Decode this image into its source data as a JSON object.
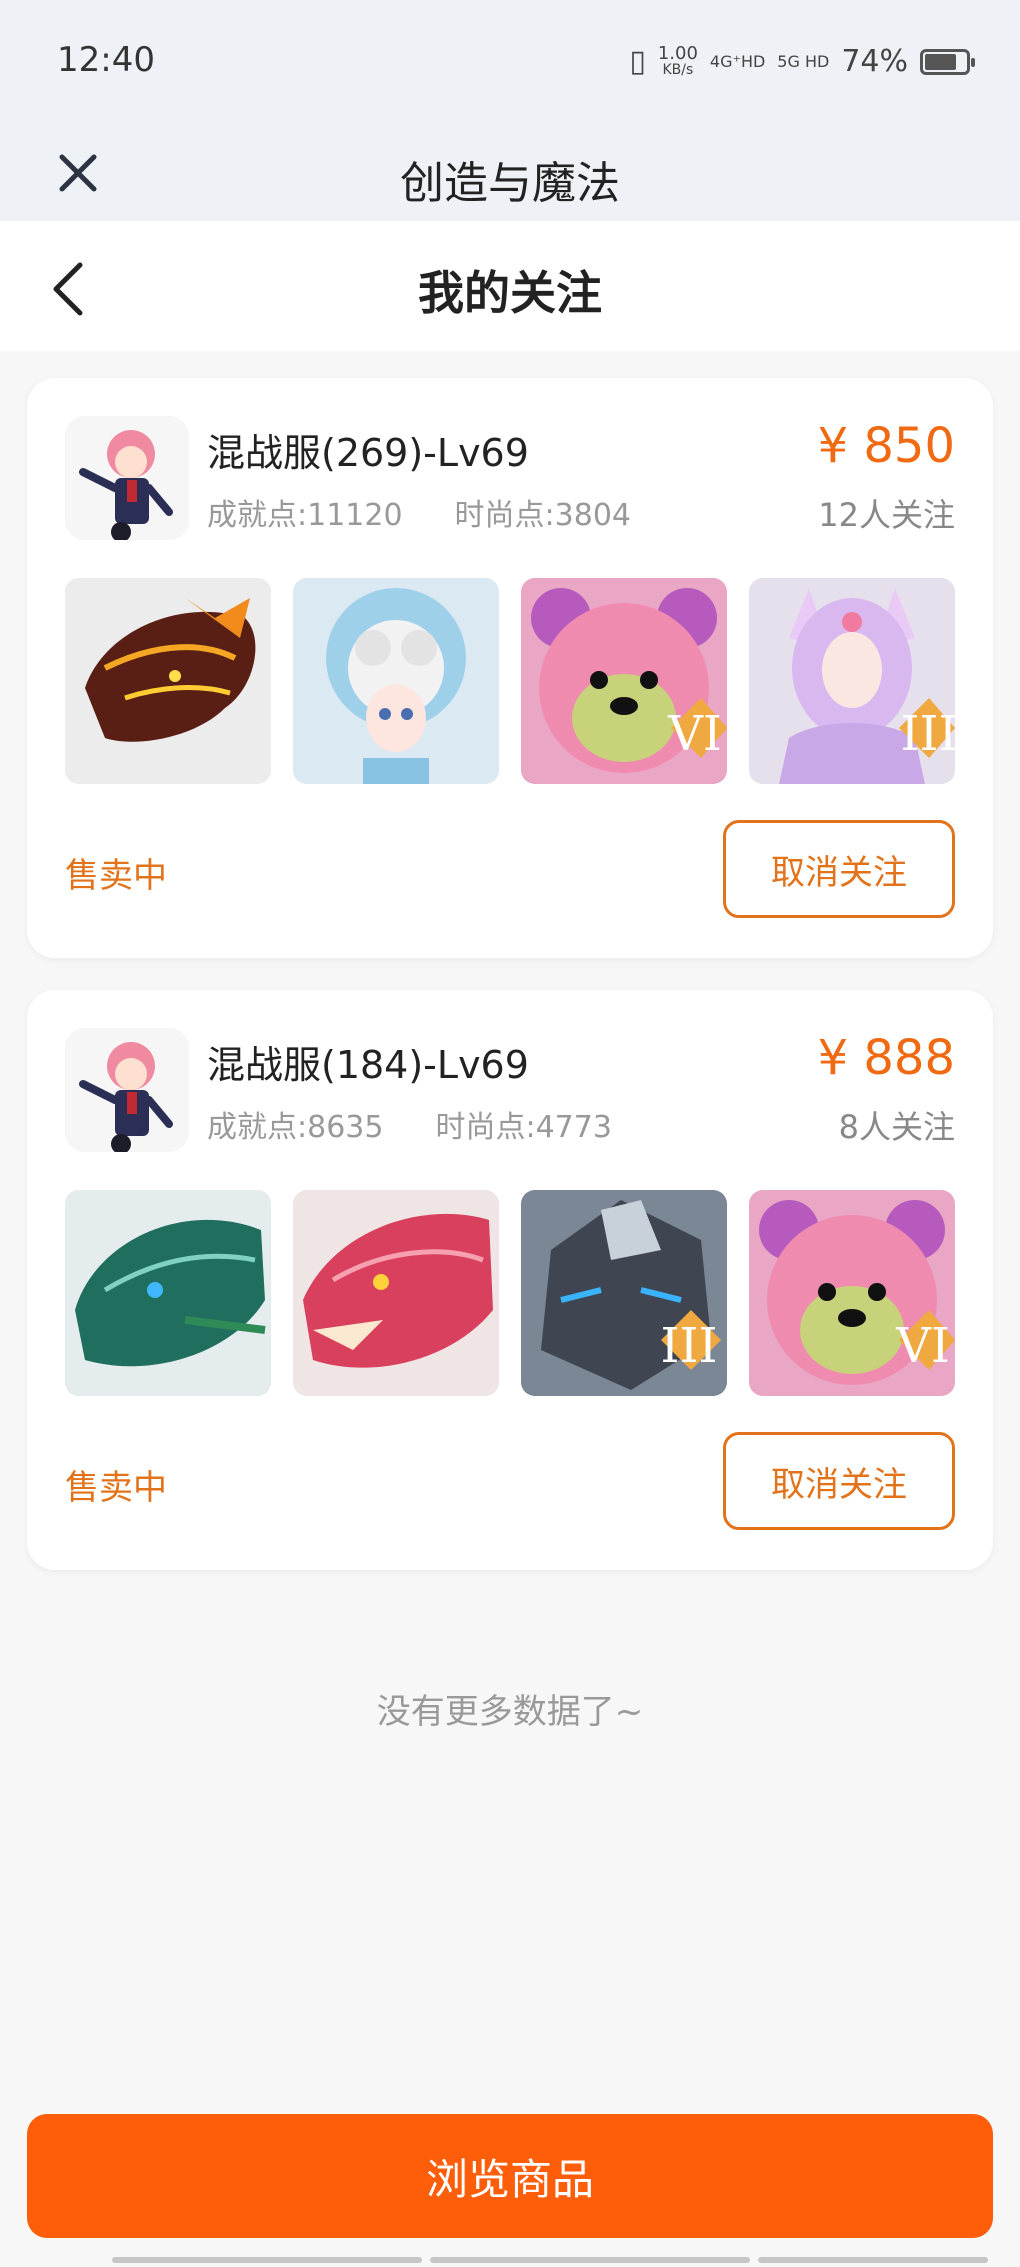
{
  "status_bar": {
    "time": "12:40",
    "speed": "1.00",
    "speed_unit": "KB/s",
    "net1": "4G⁺HD",
    "net2": "5G HD",
    "battery": "74%"
  },
  "app": {
    "title": "创造与魔法"
  },
  "page": {
    "title": "我的关注"
  },
  "listings": [
    {
      "title": "混战服(269)-Lv69",
      "achievement": "成就点:11120",
      "fashion": "时尚点:3804",
      "price": "¥ 850",
      "followers": "12人关注",
      "status": "售卖中",
      "unfollow_label": "取消关注",
      "items": [
        "dragon-mount-fire",
        "cloud-sheep-mount",
        "pink-bear-mount",
        "fox-spirit-girl"
      ],
      "item_badges": [
        "",
        "",
        "VI",
        "III"
      ]
    },
    {
      "title": "混战服(184)-Lv69",
      "achievement": "成就点:8635",
      "fashion": "时尚点:4773",
      "price": "¥ 888",
      "followers": "8人关注",
      "status": "售卖中",
      "unfollow_label": "取消关注",
      "items": [
        "dragon-mount-green",
        "dragon-mount-red",
        "stone-golem-mount",
        "pink-bear-mount"
      ],
      "item_badges": [
        "",
        "",
        "III",
        "VI"
      ]
    }
  ],
  "footer": {
    "no_more": "没有更多数据了~",
    "browse_label": "浏览商品"
  },
  "colors": {
    "accent": "#fe5e0a",
    "price": "#f06a14",
    "status": "#e2731a"
  }
}
